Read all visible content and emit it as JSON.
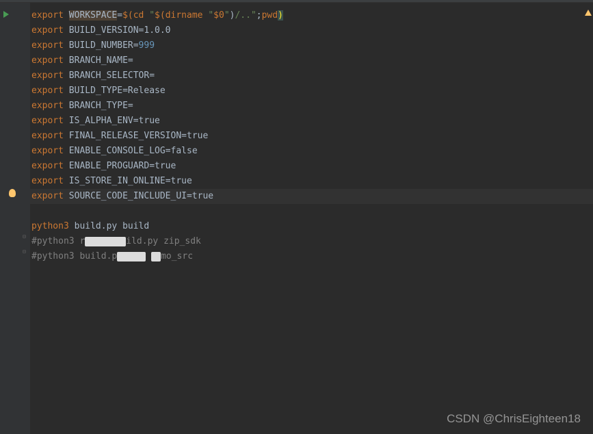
{
  "code": {
    "lines": [
      {
        "type": "export",
        "var": "WORKSPACE",
        "assign": "=",
        "cmd_open": "$(",
        "cmd": "cd",
        "sp1": " ",
        "q1": "\"",
        "inner_open": "$(",
        "dirname": "dirname",
        "sp2": " ",
        "q2": "\"",
        "arg": "$0",
        "q3": "\"",
        "inner_close": ")",
        "path": "/..",
        "q4": "\"",
        "semi": ";",
        "pwd": "pwd",
        "close": ")"
      },
      {
        "type": "export",
        "var": "BUILD_VERSION",
        "rest": "=1.0.0"
      },
      {
        "type": "export",
        "var": "BUILD_NUMBER",
        "equals": "=",
        "num": "999"
      },
      {
        "type": "export",
        "var": "BRANCH_NAME",
        "rest": "="
      },
      {
        "type": "export",
        "var": "BRANCH_SELECTOR",
        "rest": "="
      },
      {
        "type": "export",
        "var": "BUILD_TYPE",
        "rest": "=Release"
      },
      {
        "type": "export",
        "var": "BRANCH_TYPE",
        "rest": "="
      },
      {
        "type": "export",
        "var": "IS_ALPHA_ENV",
        "rest": "=true"
      },
      {
        "type": "export",
        "var": "FINAL_RELEASE_VERSION",
        "rest": "=true"
      },
      {
        "type": "export",
        "var": "ENABLE_CONSOLE_LOG",
        "rest": "=false"
      },
      {
        "type": "export",
        "var": "ENABLE_PROGUARD",
        "rest": "=true"
      },
      {
        "type": "export",
        "var": "IS_STORE_IN_ONLINE",
        "rest": "=true"
      },
      {
        "type": "export",
        "var": "SOURCE_CODE_INCLUDE_UI",
        "rest": "=true",
        "caret": true
      }
    ],
    "python_line": {
      "cmd": "python3",
      "args": " build.py build"
    },
    "comment1_prefix": "#python3 r",
    "comment1_mid": "ild.py zip_sdk",
    "comment2_prefix": "#python3 build.p",
    "comment2_mid": "mo_src"
  },
  "watermark": "CSDN @ChrisEighteen18",
  "export_kw": "export"
}
